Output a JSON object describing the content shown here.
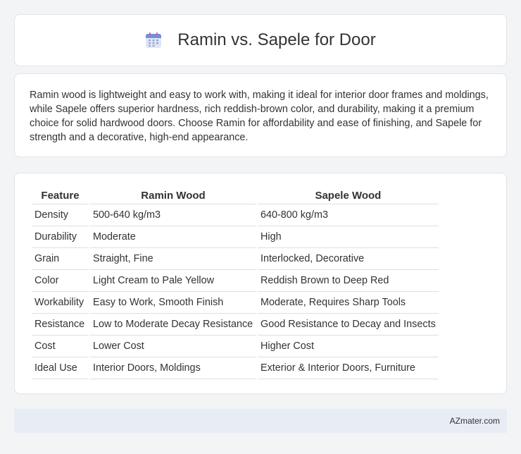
{
  "header": {
    "title": "Ramin vs. Sapele for Door",
    "icon": "calendar-icon"
  },
  "summary": {
    "text": "Ramin wood is lightweight and easy to work with, making it ideal for interior door frames and moldings, while Sapele offers superior hardness, rich reddish-brown color, and durability, making it a premium choice for solid hardwood doors. Choose Ramin for affordability and ease of finishing, and Sapele for strength and a decorative, high-end appearance."
  },
  "table": {
    "headers": [
      "Feature",
      "Ramin Wood",
      "Sapele Wood"
    ],
    "rows": [
      [
        "Density",
        "500-640 kg/m3",
        "640-800 kg/m3"
      ],
      [
        "Durability",
        "Moderate",
        "High"
      ],
      [
        "Grain",
        "Straight, Fine",
        "Interlocked, Decorative"
      ],
      [
        "Color",
        "Light Cream to Pale Yellow",
        "Reddish Brown to Deep Red"
      ],
      [
        "Workability",
        "Easy to Work, Smooth Finish",
        "Moderate, Requires Sharp Tools"
      ],
      [
        "Resistance",
        "Low to Moderate Decay Resistance",
        "Good Resistance to Decay and Insects"
      ],
      [
        "Cost",
        "Lower Cost",
        "Higher Cost"
      ],
      [
        "Ideal Use",
        "Interior Doors, Moldings",
        "Exterior & Interior Doors, Furniture"
      ]
    ]
  },
  "footer": {
    "text": "AZmater.com"
  }
}
